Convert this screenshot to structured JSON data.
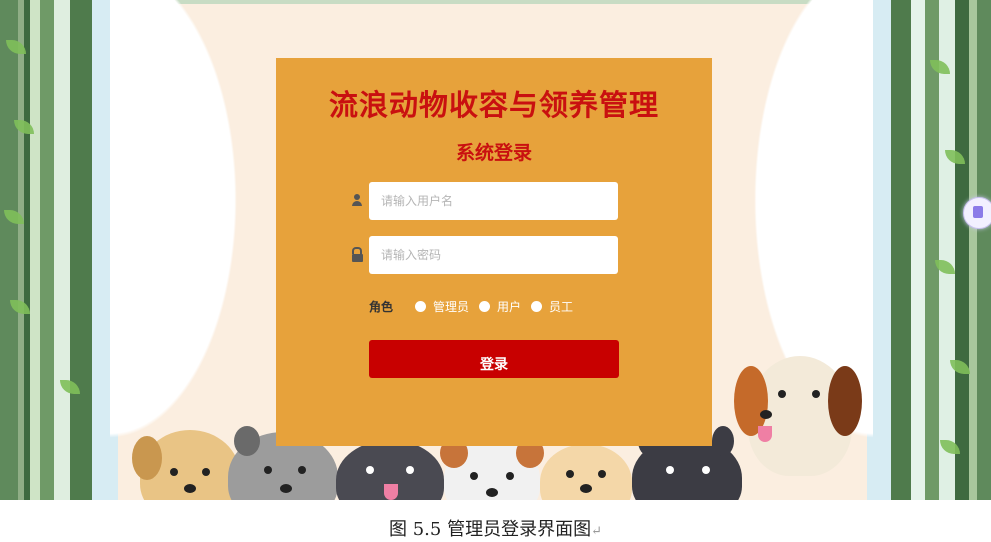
{
  "login": {
    "title": "流浪动物收容与领养管理",
    "subtitle": "系统登录",
    "username_placeholder": "请输入用户名",
    "password_placeholder": "请输入密码",
    "role_label": "角色",
    "roles": [
      "管理员",
      "用户",
      "员工"
    ],
    "login_button": "登录"
  },
  "icons": {
    "username": "user-icon",
    "password": "lock-icon",
    "side_widget": "document-icon"
  },
  "caption": {
    "text": "图 5.5 管理员登录界面图",
    "mark": "↵"
  },
  "colors": {
    "panel": "#e7a23b",
    "title": "#c91010",
    "button": "#c80000"
  }
}
